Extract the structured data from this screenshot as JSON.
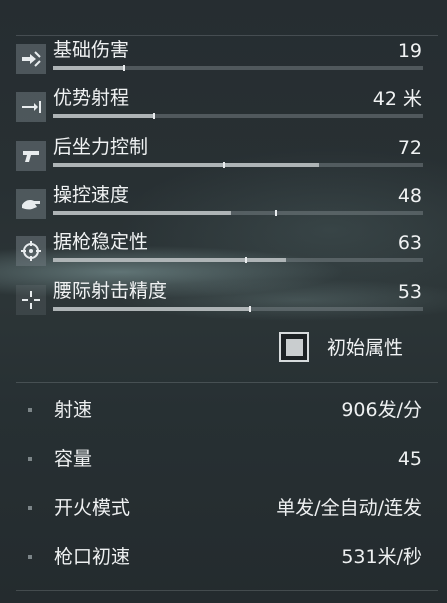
{
  "stats": [
    {
      "icon": "damage-icon",
      "label": "基础伤害",
      "value": "19",
      "fill": 0.19,
      "mark": 0.19
    },
    {
      "icon": "range-icon",
      "label": "优势射程",
      "value": "42 米",
      "fill": 0.27,
      "mark": 0.27
    },
    {
      "icon": "pistol-icon",
      "label": "后坐力控制",
      "value": "72",
      "fill": 0.72,
      "mark": 0.46
    },
    {
      "icon": "hand-icon",
      "label": "操控速度",
      "value": "48",
      "fill": 0.48,
      "mark": 0.6
    },
    {
      "icon": "crosshair-icon",
      "label": "据枪稳定性",
      "value": "63",
      "fill": 0.63,
      "mark": 0.52
    },
    {
      "icon": "hipfire-icon",
      "label": "腰际射击精度",
      "value": "53",
      "fill": 0.53,
      "mark": 0.53
    }
  ],
  "toggle": {
    "label": "初始属性",
    "checked": true
  },
  "attributes": [
    {
      "label": "射速",
      "value": "906发/分"
    },
    {
      "label": "容量",
      "value": "45"
    },
    {
      "label": "开火模式",
      "value": "单发/全自动/连发"
    },
    {
      "label": "枪口初速",
      "value": "531米/秒"
    }
  ]
}
